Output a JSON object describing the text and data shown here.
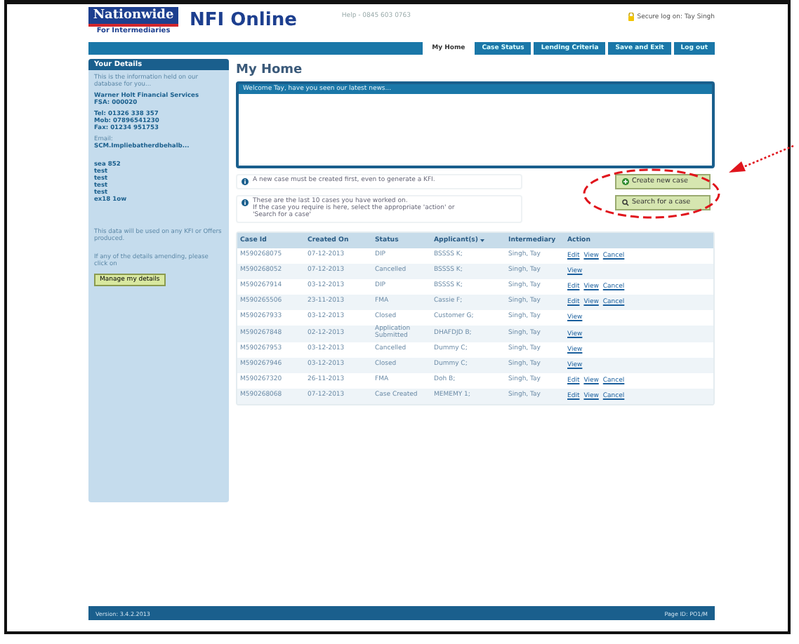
{
  "header": {
    "brand": "Nationwide",
    "brand_sub": "For Intermediaries",
    "app_title": "NFI Online",
    "help": "Help - 0845 603 0763",
    "secure": "Secure log on: Tay Singh"
  },
  "nav": [
    {
      "label": "My Home",
      "selected": true
    },
    {
      "label": "Case Status",
      "selected": false
    },
    {
      "label": "Lending Criteria",
      "selected": false
    },
    {
      "label": "Save and Exit",
      "selected": false
    },
    {
      "label": "Log out",
      "selected": false
    }
  ],
  "sidebar": {
    "title": "Your Details",
    "intro": "This is the information held on our database for you...",
    "company": [
      "Warner Holt Financial Services",
      "FSA: 000020"
    ],
    "contact": [
      "Tel: 01326 338 357",
      "Mob: 07896541230",
      "Fax: 01234 951753"
    ],
    "email_label": "Email:",
    "email": "SCM.Impliebatherdbehalb...",
    "address": [
      "sea 852",
      "test",
      "test",
      "test",
      "test",
      "ex18 1ow"
    ],
    "note": "This data will be used on any KFI or Offers produced.",
    "amend": "If any of the details amending, please click on",
    "button": "Manage my details"
  },
  "page_title": "My Home",
  "news": {
    "title": "Welcome Tay, have you seen our latest news..."
  },
  "notices": [
    {
      "lines": [
        "A new case must be created first, even to generate a KFI."
      ]
    },
    {
      "lines": [
        "These are the last 10 cases you have worked on.",
        "If the case you require is here, select the appropriate 'action' or",
        "'Search for a case'"
      ]
    }
  ],
  "actions": [
    {
      "label": "Create new case",
      "kind": "create"
    },
    {
      "label": "Search for a case",
      "kind": "search"
    }
  ],
  "table": {
    "columns": [
      "Case Id",
      "Created On",
      "Status",
      "Applicant(s)",
      "Intermediary",
      "Action"
    ],
    "rows": [
      {
        "case_id": "M590268075",
        "created_on": "07-12-2013",
        "status": "DIP",
        "applicant": "BSSSS K;",
        "intermediary": "Singh, Tay",
        "actions": [
          "Edit",
          "View",
          "Cancel"
        ]
      },
      {
        "case_id": "M590268052",
        "created_on": "07-12-2013",
        "status": "Cancelled",
        "applicant": "BSSSS K;",
        "intermediary": "Singh, Tay",
        "actions": [
          "View"
        ]
      },
      {
        "case_id": "M590267914",
        "created_on": "03-12-2013",
        "status": "DIP",
        "applicant": "BSSSS K;",
        "intermediary": "Singh, Tay",
        "actions": [
          "Edit",
          "View",
          "Cancel"
        ]
      },
      {
        "case_id": "M590265506",
        "created_on": "23-11-2013",
        "status": "FMA",
        "applicant": "Cassie F;",
        "intermediary": "Singh, Tay",
        "actions": [
          "Edit",
          "View",
          "Cancel"
        ]
      },
      {
        "case_id": "M590267933",
        "created_on": "03-12-2013",
        "status": "Closed",
        "applicant": "Customer G;",
        "intermediary": "Singh, Tay",
        "actions": [
          "View"
        ]
      },
      {
        "case_id": "M590267848",
        "created_on": "02-12-2013",
        "status": "Application Submitted",
        "applicant": "DHAFDJD B;",
        "intermediary": "Singh, Tay",
        "actions": [
          "View"
        ]
      },
      {
        "case_id": "M590267953",
        "created_on": "03-12-2013",
        "status": "Cancelled",
        "applicant": "Dummy C;",
        "intermediary": "Singh, Tay",
        "actions": [
          "View"
        ]
      },
      {
        "case_id": "M590267946",
        "created_on": "03-12-2013",
        "status": "Closed",
        "applicant": "Dummy C;",
        "intermediary": "Singh, Tay",
        "actions": [
          "View"
        ]
      },
      {
        "case_id": "M590267320",
        "created_on": "26-11-2013",
        "status": "FMA",
        "applicant": "Doh B;",
        "intermediary": "Singh, Tay",
        "actions": [
          "Edit",
          "View",
          "Cancel"
        ]
      },
      {
        "case_id": "M590268068",
        "created_on": "07-12-2013",
        "status": "Case Created",
        "applicant": "MEMEMY 1;",
        "intermediary": "Singh, Tay",
        "actions": [
          "Edit",
          "View",
          "Cancel"
        ]
      }
    ]
  },
  "footer": {
    "version": "Version: 3.4.2.2013",
    "page_id": "Page ID: PO1/M"
  }
}
